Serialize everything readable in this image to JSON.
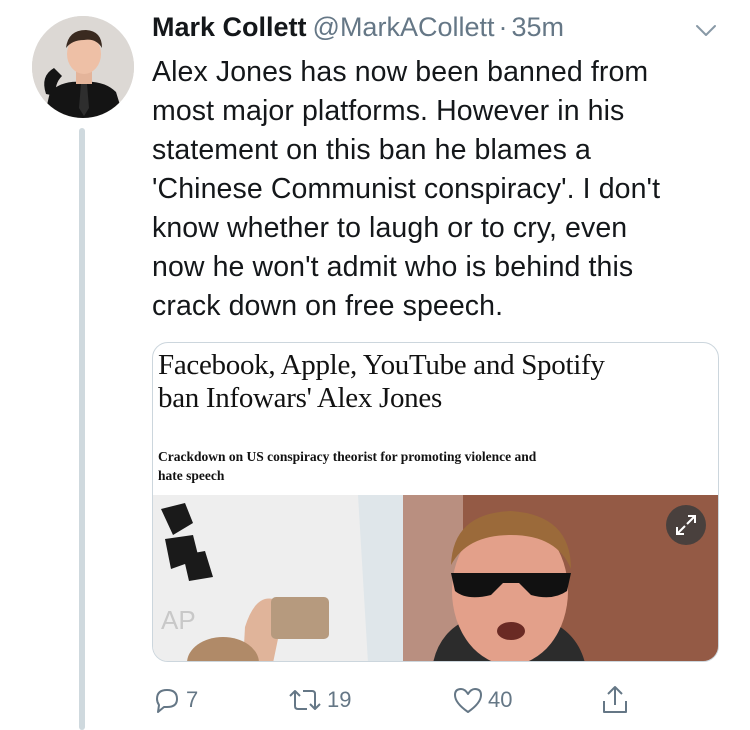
{
  "tweet": {
    "author_name": "Mark Collett",
    "author_handle": "@MarkACollett",
    "separator": "·",
    "time": "35m",
    "text_lines": [
      "Alex Jones has now been banned from",
      "most major platforms. However in his",
      "statement on this ban he blames a",
      "'Chinese Communist conspiracy'. I don't",
      "know whether to laugh or to cry, even",
      "now he won't admit who is behind this",
      "crack down on free speech."
    ]
  },
  "card": {
    "headline_lines": [
      "Facebook, Apple, YouTube and Spotify",
      "ban Infowars' Alex Jones"
    ],
    "subhead_lines": [
      "Crackdown on US conspiracy theorist for promoting violence and",
      "hate speech"
    ]
  },
  "actions": {
    "reply_count": "7",
    "retweet_count": "19",
    "like_count": "40"
  },
  "colors": {
    "text": "#14171a",
    "secondary": "#657786",
    "border": "#ccd6dd",
    "thread_line": "#cfd9de"
  },
  "icons": [
    "caret-down-icon",
    "expand-icon",
    "reply-icon",
    "retweet-icon",
    "like-icon",
    "share-icon"
  ]
}
